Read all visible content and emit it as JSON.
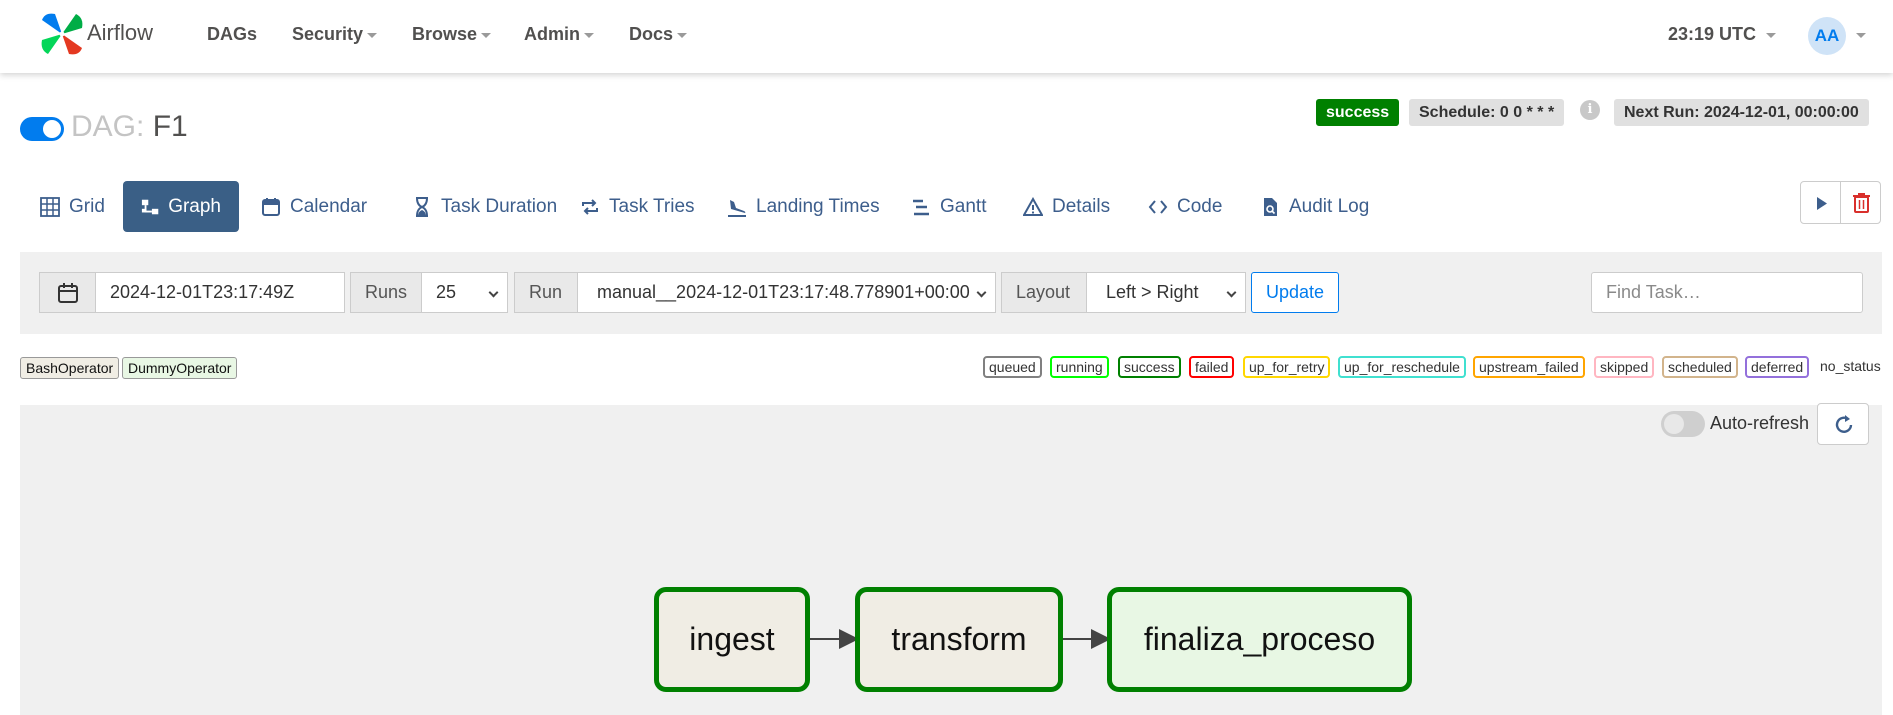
{
  "navbar": {
    "brand": "Airflow",
    "items": [
      {
        "label": "DAGs",
        "dropdown": false
      },
      {
        "label": "Security",
        "dropdown": true
      },
      {
        "label": "Browse",
        "dropdown": true
      },
      {
        "label": "Admin",
        "dropdown": true
      },
      {
        "label": "Docs",
        "dropdown": true
      }
    ],
    "time": "23:19 UTC",
    "avatar_initials": "AA"
  },
  "dag": {
    "prefix": "DAG:",
    "name": "F1",
    "paused": false,
    "status": "success",
    "schedule": "Schedule: 0 0 * * *",
    "next_run": "Next Run: 2024-12-01, 00:00:00"
  },
  "tabs": [
    {
      "label": "Grid",
      "icon": "grid-icon",
      "active": false
    },
    {
      "label": "Graph",
      "icon": "graph-icon",
      "active": true
    },
    {
      "label": "Calendar",
      "icon": "calendar-icon",
      "active": false
    },
    {
      "label": "Task Duration",
      "icon": "hourglass-icon",
      "active": false
    },
    {
      "label": "Task Tries",
      "icon": "retry-icon",
      "active": false
    },
    {
      "label": "Landing Times",
      "icon": "plane-landing-icon",
      "active": false
    },
    {
      "label": "Gantt",
      "icon": "gantt-icon",
      "active": false
    },
    {
      "label": "Details",
      "icon": "warning-triangle-icon",
      "active": false
    },
    {
      "label": "Code",
      "icon": "code-icon",
      "active": false
    },
    {
      "label": "Audit Log",
      "icon": "audit-file-icon",
      "active": false
    }
  ],
  "filters": {
    "date": "2024-12-01T23:17:49Z",
    "runs_label": "Runs",
    "runs_value": "25",
    "run_label": "Run",
    "run_value": "manual__2024-12-01T23:17:48.778901+00:00",
    "layout_label": "Layout",
    "layout_value": "Left > Right",
    "update_label": "Update",
    "find_placeholder": "Find Task…"
  },
  "operators": [
    {
      "label": "BashOperator",
      "color": "#f0ede4"
    },
    {
      "label": "DummyOperator",
      "color": "#e8f7e4"
    }
  ],
  "states": [
    {
      "label": "queued",
      "color": "#808080"
    },
    {
      "label": "running",
      "color": "#00ff00"
    },
    {
      "label": "success",
      "color": "#008000"
    },
    {
      "label": "failed",
      "color": "#ff0000"
    },
    {
      "label": "up_for_retry",
      "color": "#ffd700"
    },
    {
      "label": "up_for_reschedule",
      "color": "#40e0d0"
    },
    {
      "label": "upstream_failed",
      "color": "#ffa500"
    },
    {
      "label": "skipped",
      "color": "#ffb6c1"
    },
    {
      "label": "scheduled",
      "color": "#d2b48c"
    },
    {
      "label": "deferred",
      "color": "#9370db"
    }
  ],
  "no_status": "no_status",
  "graph": {
    "auto_refresh_label": "Auto-refresh",
    "auto_refresh_on": false,
    "nodes": [
      {
        "label": "ingest",
        "operator": "BashOperator",
        "state": "success"
      },
      {
        "label": "transform",
        "operator": "BashOperator",
        "state": "success"
      },
      {
        "label": "finaliza_proceso",
        "operator": "DummyOperator",
        "state": "success"
      }
    ]
  },
  "colors": {
    "accent": "#017cee",
    "tab_active": "#3a5f86",
    "success": "#008000"
  }
}
